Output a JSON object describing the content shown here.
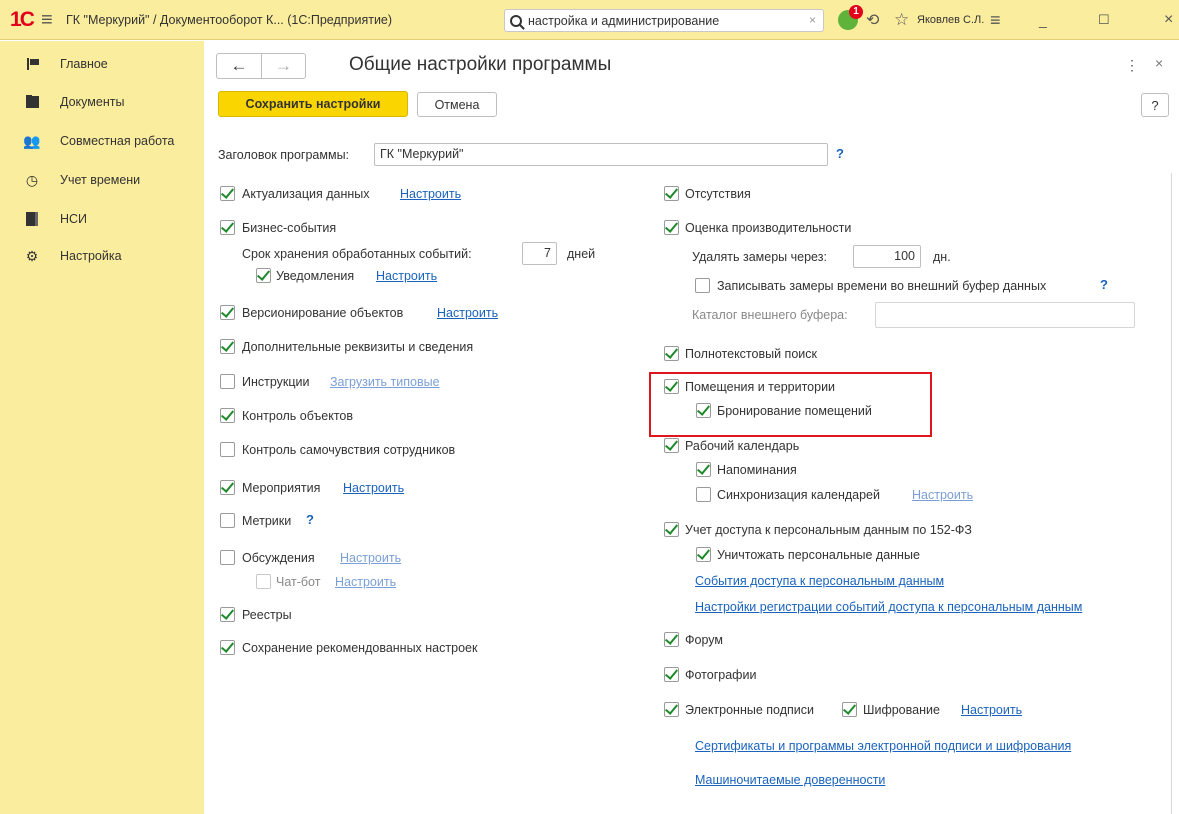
{
  "window": {
    "app_title": "ГК \"Меркурий\" / Документооборот К...  (1С:Предприятие)",
    "search_value": "настройка и администрирование",
    "notification_count": "1",
    "user": "Яковлев С.Л."
  },
  "sidebar": {
    "items": [
      {
        "label": "Главное",
        "icon": "flag-icon"
      },
      {
        "label": "Документы",
        "icon": "folder-icon"
      },
      {
        "label": "Совместная работа",
        "icon": "users-icon"
      },
      {
        "label": "Учет времени",
        "icon": "clock-icon"
      },
      {
        "label": "НСИ",
        "icon": "catalog-icon"
      },
      {
        "label": "Настройка",
        "icon": "gear-icon"
      }
    ]
  },
  "page": {
    "title": "Общие настройки программы",
    "save_label": "Сохранить настройки",
    "cancel_label": "Отмена",
    "help_label": "?",
    "header_label": "Заголовок программы:",
    "header_value": "ГК \"Меркурий\"",
    "header_help": "?"
  },
  "left": {
    "actualization": {
      "label": "Актуализация данных",
      "checked": true,
      "link": "Настроить"
    },
    "business_events": {
      "label": "Бизнес-события",
      "checked": true
    },
    "events_retention_label": "Срок хранения обработанных событий:",
    "events_retention_value": "7",
    "events_retention_unit": "дней",
    "notifications": {
      "label": "Уведомления",
      "checked": true,
      "link": "Настроить"
    },
    "versioning": {
      "label": "Версионирование объектов",
      "checked": true,
      "link": "Настроить"
    },
    "additional_props": {
      "label": "Дополнительные реквизиты и сведения",
      "checked": true
    },
    "instructions": {
      "label": "Инструкции",
      "checked": false,
      "link": "Загрузить типовые"
    },
    "object_control": {
      "label": "Контроль объектов",
      "checked": true
    },
    "wellbeing": {
      "label": "Контроль самочувствия сотрудников",
      "checked": false
    },
    "events": {
      "label": "Мероприятия",
      "checked": true,
      "link": "Настроить"
    },
    "metrics": {
      "label": "Метрики",
      "checked": false,
      "help": "?"
    },
    "discussions": {
      "label": "Обсуждения",
      "checked": false,
      "link": "Настроить"
    },
    "chatbot": {
      "label": "Чат-бот",
      "checked": false,
      "link": "Настроить"
    },
    "registers": {
      "label": "Реестры",
      "checked": true
    },
    "recommended": {
      "label": "Сохранение рекомендованных настроек",
      "checked": true
    }
  },
  "right": {
    "absences": {
      "label": "Отсутствия",
      "checked": true
    },
    "performance": {
      "label": "Оценка производительности",
      "checked": true
    },
    "delete_after_label": "Удалять замеры через:",
    "delete_after_value": "100",
    "delete_after_unit": "дн.",
    "external_buffer": {
      "label": "Записывать замеры времени во внешний буфер данных",
      "checked": false,
      "help": "?"
    },
    "buffer_dir_label": "Каталог внешнего буфера:",
    "fulltext": {
      "label": "Полнотекстовый поиск",
      "checked": true
    },
    "premises": {
      "label": "Помещения и территории",
      "checked": true
    },
    "booking": {
      "label": "Бронирование помещений",
      "checked": true
    },
    "work_calendar": {
      "label": "Рабочий календарь",
      "checked": true
    },
    "reminders": {
      "label": "Напоминания",
      "checked": true
    },
    "calendar_sync": {
      "label": "Синхронизация календарей",
      "checked": false,
      "link": "Настроить"
    },
    "pd_access": {
      "label": "Учет доступа к персональным данным по 152-ФЗ",
      "checked": true
    },
    "destroy_pd": {
      "label": "Уничтожать персональные данные",
      "checked": true
    },
    "pd_events_link": "События доступа к персональным данным",
    "pd_settings_link": "Настройки регистрации событий доступа к персональным данным",
    "forum": {
      "label": "Форум",
      "checked": true
    },
    "photos": {
      "label": "Фотографии",
      "checked": true
    },
    "esign": {
      "label": "Электронные подписи",
      "checked": true
    },
    "encryption": {
      "label": "Шифрование",
      "checked": true,
      "link": "Настроить"
    },
    "certs_link": "Сертификаты и программы электронной подписи и шифрования",
    "mchd_link": "Машиночитаемые доверенности"
  },
  "colors": {
    "accent": "#fbd500",
    "panel": "#fbed9e",
    "link": "#1a63bc",
    "highlight": "#e0161f"
  }
}
